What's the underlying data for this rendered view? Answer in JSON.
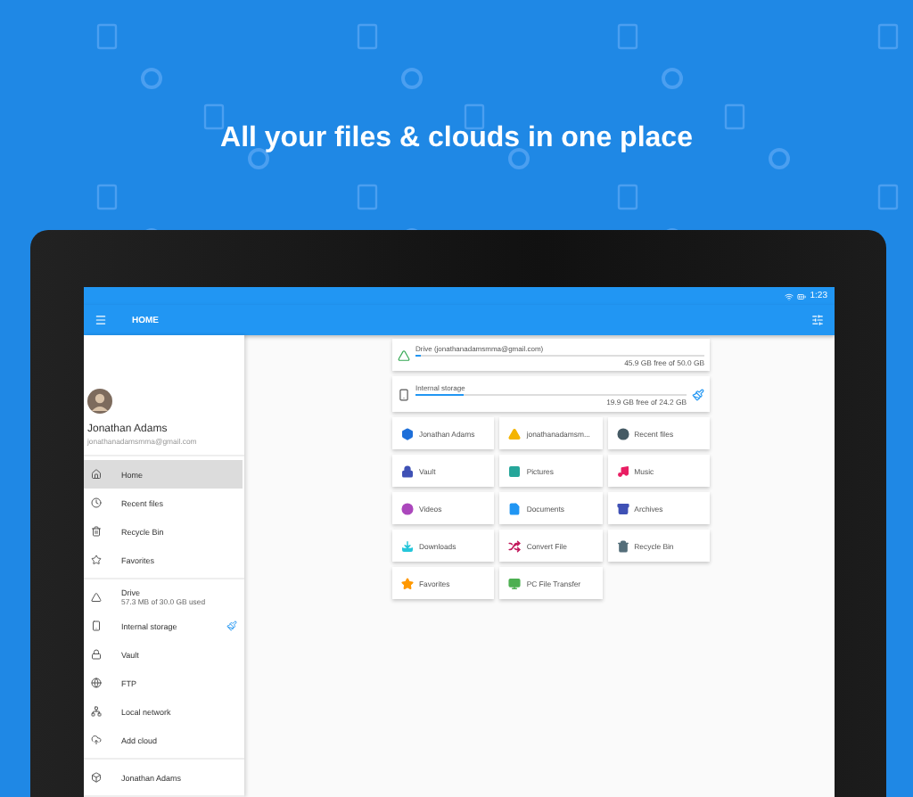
{
  "headline": "All your files & clouds in one place",
  "status_bar": {
    "time": "1:23"
  },
  "app_bar": {
    "title": "HOME"
  },
  "account": {
    "name": "Jonathan Adams",
    "email": "jonathanadamsmma@gmail.com"
  },
  "nav": [
    {
      "items": [
        {
          "kind": "home",
          "label": "Home",
          "selected": true
        },
        {
          "kind": "recent",
          "label": "Recent files",
          "selected": false
        },
        {
          "kind": "bin",
          "label": "Recycle Bin",
          "selected": false
        },
        {
          "kind": "favorites",
          "label": "Favorites",
          "selected": false
        }
      ]
    },
    {
      "items": [
        {
          "kind": "drive",
          "label": "Drive",
          "detail": "57.3 MB of 30.0 GB used",
          "selected": false
        },
        {
          "kind": "internal",
          "label": "Internal storage",
          "selected": false
        },
        {
          "kind": "vault",
          "label": "Vault",
          "selected": false
        },
        {
          "kind": "ftp",
          "label": "FTP",
          "selected": false
        },
        {
          "kind": "network",
          "label": "Local network",
          "selected": false
        },
        {
          "kind": "cloud",
          "label": "Add cloud",
          "selected": false
        }
      ]
    },
    {
      "items": [
        {
          "kind": "dropbox",
          "label": "Jonathan Adams",
          "selected": false
        }
      ]
    }
  ],
  "storage": [
    {
      "kind": "drive",
      "label": "Drive (jonathanadamsmma@gmail.com)",
      "free": "45.9 GB free of 50.0 GB",
      "level": 0.02
    },
    {
      "kind": "internal",
      "label": "Internal storage",
      "free": "19.9 GB free of 24.2 GB",
      "level": 0.18
    }
  ],
  "tiles": [
    {
      "kind": "dropbox",
      "label": "Jonathan Adams",
      "color": "#1e6fd9"
    },
    {
      "kind": "drive",
      "label": "jonathanadamsm...",
      "color": "#f4b400"
    },
    {
      "kind": "recent",
      "label": "Recent files",
      "color": "#455a64"
    },
    {
      "kind": "vault",
      "label": "Vault",
      "color": "#3f51b5"
    },
    {
      "kind": "pictures",
      "label": "Pictures",
      "color": "#26a69a"
    },
    {
      "kind": "music",
      "label": "Music",
      "color": "#e91e63"
    },
    {
      "kind": "videos",
      "label": "Videos",
      "color": "#ab47bc"
    },
    {
      "kind": "documents",
      "label": "Documents",
      "color": "#2196f3"
    },
    {
      "kind": "archives",
      "label": "Archives",
      "color": "#3f51b5"
    },
    {
      "kind": "downloads",
      "label": "Downloads",
      "color": "#26c6da"
    },
    {
      "kind": "convert",
      "label": "Convert File",
      "color": "#c2185b"
    },
    {
      "kind": "bin",
      "label": "Recycle Bin",
      "color": "#546e7a"
    },
    {
      "kind": "favorites",
      "label": "Favorites",
      "color": "#ff9800"
    },
    {
      "kind": "transfer",
      "label": "PC File Transfer",
      "color": "#4caf50"
    }
  ]
}
